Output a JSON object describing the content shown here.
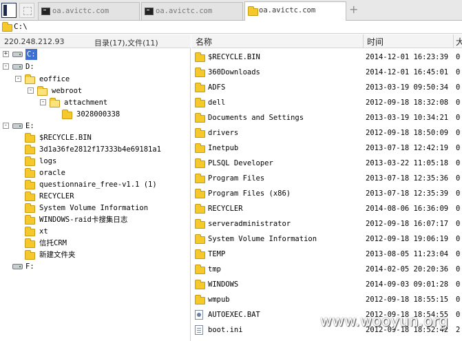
{
  "tabs": [
    {
      "label": "oa.avictc.com",
      "icon": "terminal-icon",
      "active": false
    },
    {
      "label": "oa.avictc.com",
      "icon": "terminal-icon",
      "active": false
    },
    {
      "label": "oa.avictc.com",
      "icon": "folder-icon",
      "active": true
    }
  ],
  "tab_plus": "+",
  "address": {
    "path": "C:\\"
  },
  "left": {
    "ip": "220.248.212.93",
    "count": "目录(17),文件(11)",
    "tree": [
      {
        "label": "C:",
        "type": "drive",
        "expander": "+",
        "selected": true
      },
      {
        "label": "D:",
        "type": "drive",
        "expander": "-"
      },
      {
        "label": "eoffice",
        "type": "folder",
        "expander": "-"
      },
      {
        "label": "webroot",
        "type": "folder",
        "expander": "-"
      },
      {
        "label": "attachment",
        "type": "folder",
        "expander": "-"
      },
      {
        "label": "3028000338",
        "type": "folder"
      },
      {
        "label": "E:",
        "type": "drive",
        "expander": "-"
      },
      {
        "label": "$RECYCLE.BIN",
        "type": "folder"
      },
      {
        "label": "3d1a36fe2812f17333b4e69181a1",
        "type": "folder"
      },
      {
        "label": "logs",
        "type": "folder"
      },
      {
        "label": "oracle",
        "type": "folder"
      },
      {
        "label": "questionnaire_free-v1.1 (1)",
        "type": "folder"
      },
      {
        "label": "RECYCLER",
        "type": "folder"
      },
      {
        "label": "System Volume Information",
        "type": "folder"
      },
      {
        "label": "WINDOWS-raid卡搜集日志",
        "type": "folder"
      },
      {
        "label": "xt",
        "type": "folder"
      },
      {
        "label": "信托CRM",
        "type": "folder"
      },
      {
        "label": "新建文件夹",
        "type": "folder"
      },
      {
        "label": "F:",
        "type": "drive"
      }
    ]
  },
  "grid": {
    "headers": {
      "name": "名称",
      "time": "时间",
      "size": "大"
    },
    "rows": [
      {
        "name": "$RECYCLE.BIN",
        "time": "2014-12-01 16:23:39",
        "size": "0",
        "type": "folder"
      },
      {
        "name": "360Downloads",
        "time": "2014-12-01 16:45:01",
        "size": "0",
        "type": "folder"
      },
      {
        "name": "ADFS",
        "time": "2013-03-19 09:50:34",
        "size": "0",
        "type": "folder"
      },
      {
        "name": "dell",
        "time": "2012-09-18 18:32:08",
        "size": "0",
        "type": "folder"
      },
      {
        "name": "Documents and Settings",
        "time": "2013-03-19 10:34:21",
        "size": "0",
        "type": "folder"
      },
      {
        "name": "drivers",
        "time": "2012-09-18 18:50:09",
        "size": "0",
        "type": "folder"
      },
      {
        "name": "Inetpub",
        "time": "2013-07-18 12:42:19",
        "size": "0",
        "type": "folder"
      },
      {
        "name": "PLSQL Developer",
        "time": "2013-03-22 11:05:18",
        "size": "0",
        "type": "folder"
      },
      {
        "name": "Program Files",
        "time": "2013-07-18 12:35:36",
        "size": "0",
        "type": "folder"
      },
      {
        "name": "Program Files (x86)",
        "time": "2013-07-18 12:35:39",
        "size": "0",
        "type": "folder"
      },
      {
        "name": "RECYCLER",
        "time": "2014-08-06 16:36:09",
        "size": "0",
        "type": "folder"
      },
      {
        "name": "serveradministrator",
        "time": "2012-09-18 16:07:17",
        "size": "0",
        "type": "folder"
      },
      {
        "name": "System Volume Information",
        "time": "2012-09-18 19:06:19",
        "size": "0",
        "type": "folder"
      },
      {
        "name": "TEMP",
        "time": "2013-08-05 11:23:04",
        "size": "0",
        "type": "folder"
      },
      {
        "name": "tmp",
        "time": "2014-02-05 20:20:36",
        "size": "0",
        "type": "folder"
      },
      {
        "name": "WINDOWS",
        "time": "2014-09-03 09:01:28",
        "size": "0",
        "type": "folder"
      },
      {
        "name": "wmpub",
        "time": "2012-09-18 18:55:15",
        "size": "0",
        "type": "folder"
      },
      {
        "name": "AUTOEXEC.BAT",
        "time": "2012-09-18 18:54:55",
        "size": "0",
        "type": "bat"
      },
      {
        "name": "boot.ini",
        "time": "2012-09-18 18:52:42",
        "size": "2",
        "type": "ini"
      }
    ]
  },
  "watermark": "www.wooyun.org"
}
